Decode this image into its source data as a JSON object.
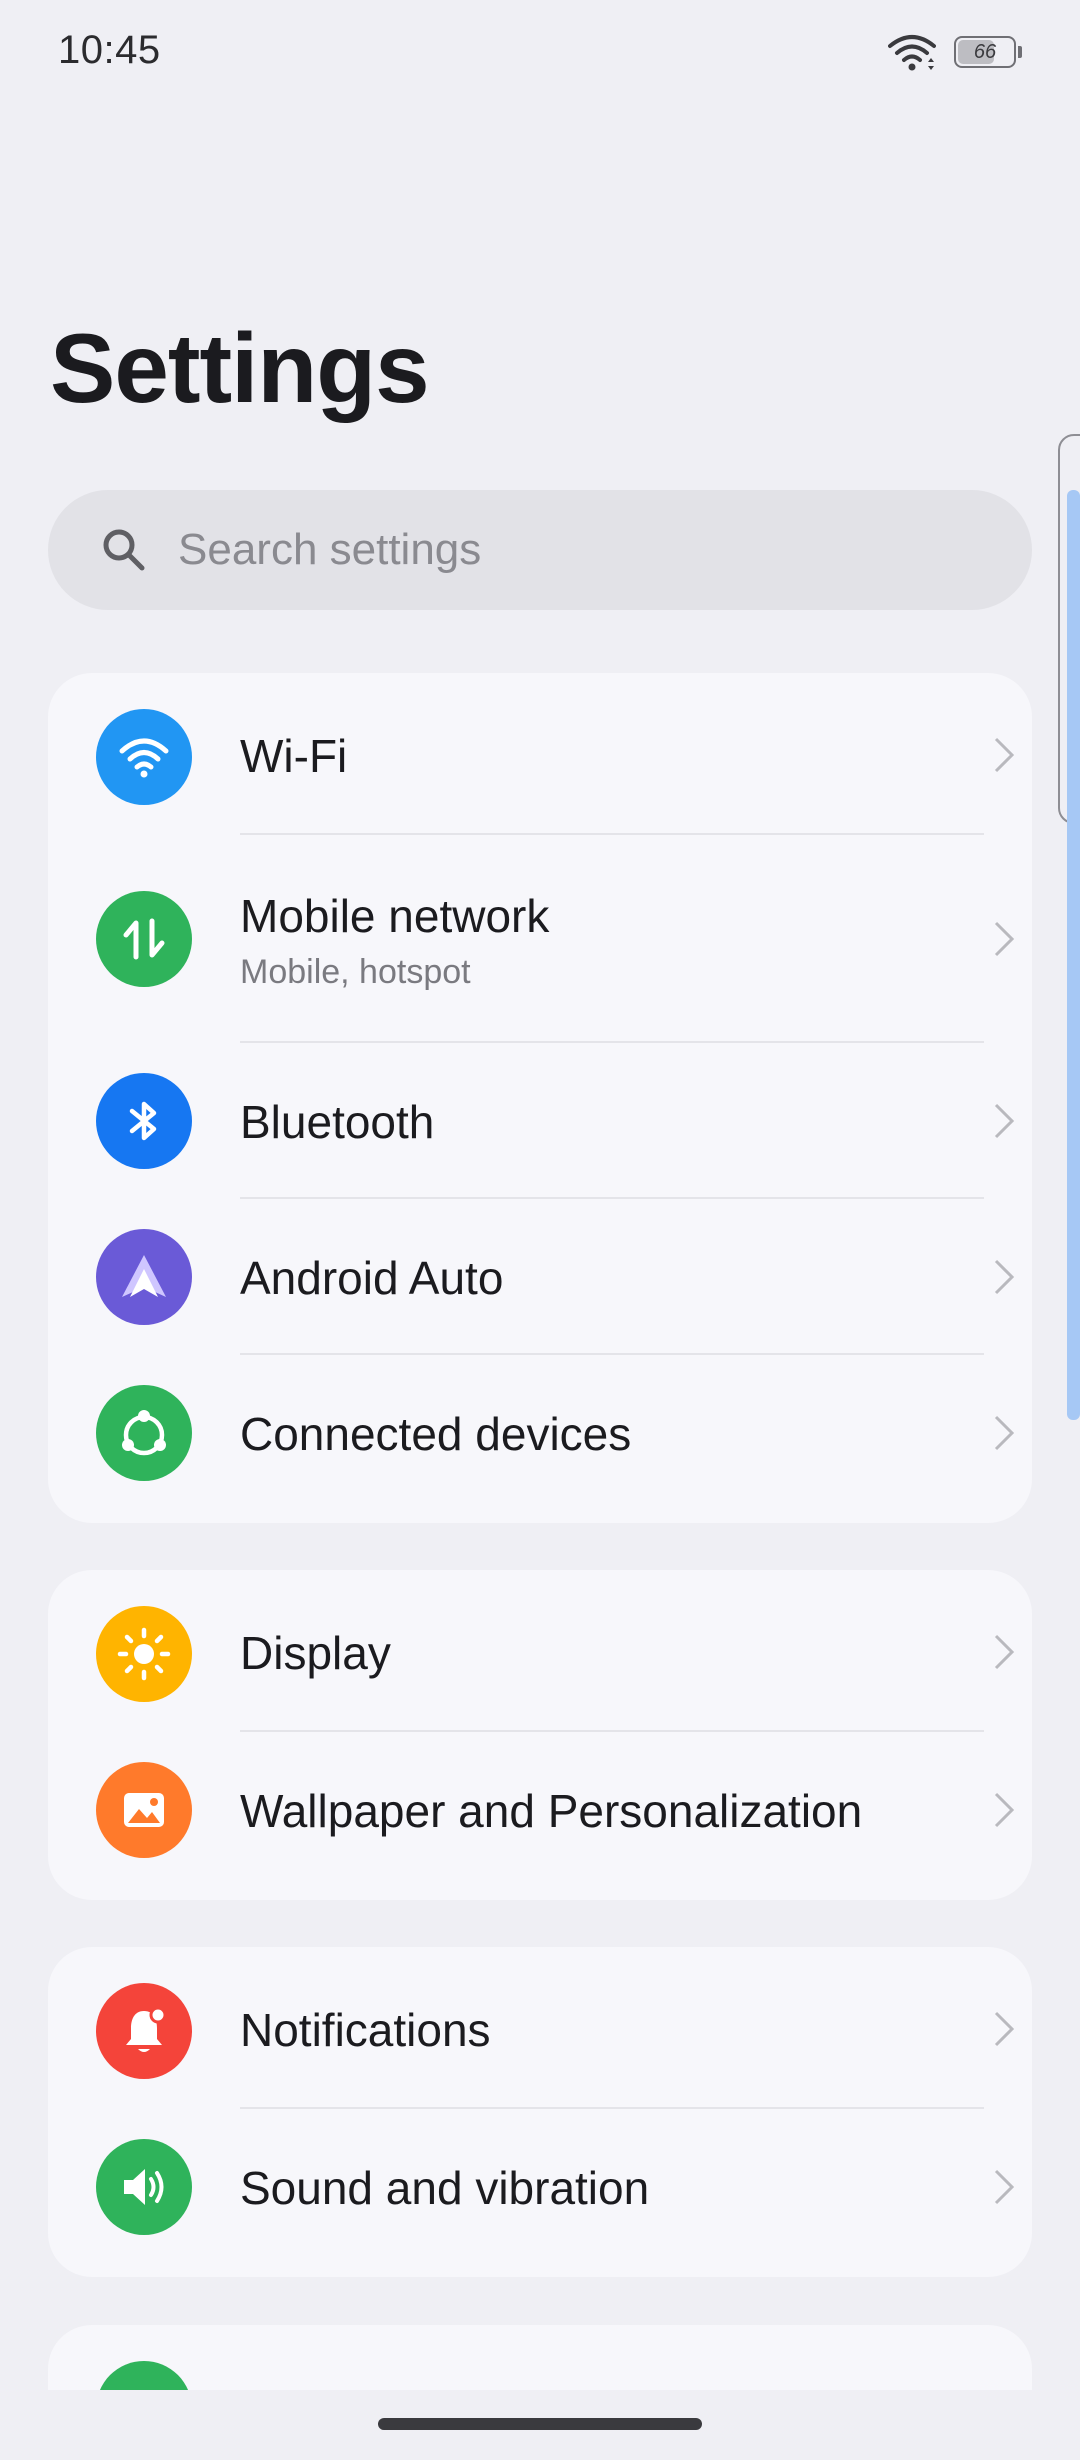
{
  "status_bar": {
    "time": "10:45",
    "battery_level": "66",
    "battery_fraction": 0.66
  },
  "page": {
    "title": "Settings"
  },
  "search": {
    "placeholder": "Search settings"
  },
  "groups": [
    {
      "items": [
        {
          "label": "Wi-Fi",
          "icon": "wifi-icon",
          "color": "#2196f3"
        },
        {
          "label": "Mobile network",
          "sublabel": "Mobile, hotspot",
          "icon": "mobile-data-icon",
          "color": "#2fb35b"
        },
        {
          "label": "Bluetooth",
          "icon": "bluetooth-icon",
          "color": "#1677f2"
        },
        {
          "label": "Android Auto",
          "icon": "android-auto-icon",
          "color": "#6a5ad7"
        },
        {
          "label": "Connected devices",
          "icon": "connected-devices-icon",
          "color": "#2fb35b"
        }
      ]
    },
    {
      "items": [
        {
          "label": "Display",
          "icon": "sun-icon",
          "color": "#ffb400"
        },
        {
          "label": "Wallpaper and Personalization",
          "icon": "image-icon",
          "color": "#ff7a2b"
        }
      ]
    },
    {
      "items": [
        {
          "label": "Notifications",
          "icon": "bell-icon",
          "color": "#f4443a"
        },
        {
          "label": "Sound and vibration",
          "icon": "speaker-icon",
          "color": "#2fb35b"
        }
      ]
    }
  ]
}
